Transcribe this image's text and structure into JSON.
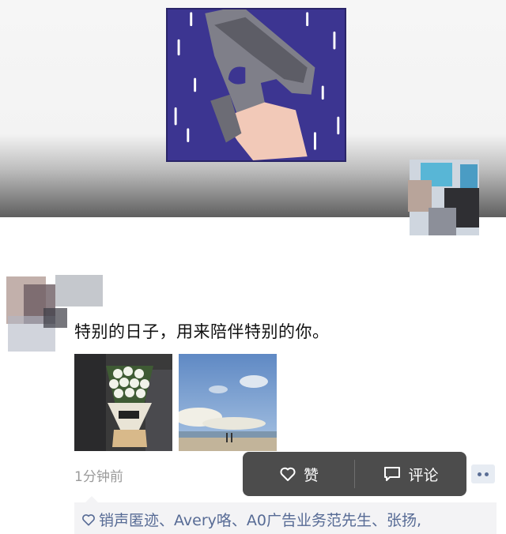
{
  "post": {
    "text": "特别的日子，用来陪伴特别的你。",
    "time": "1分钟前"
  },
  "popup": {
    "like_label": "赞",
    "comment_label": "评论"
  },
  "likes": {
    "names": "销声匿迹、Avery咯、A0广告业务范先生、张扬,"
  },
  "colors": {
    "link": "#576b95",
    "popup_bg": "#4c4c4c",
    "cover_art_bg": "#3c3591"
  }
}
